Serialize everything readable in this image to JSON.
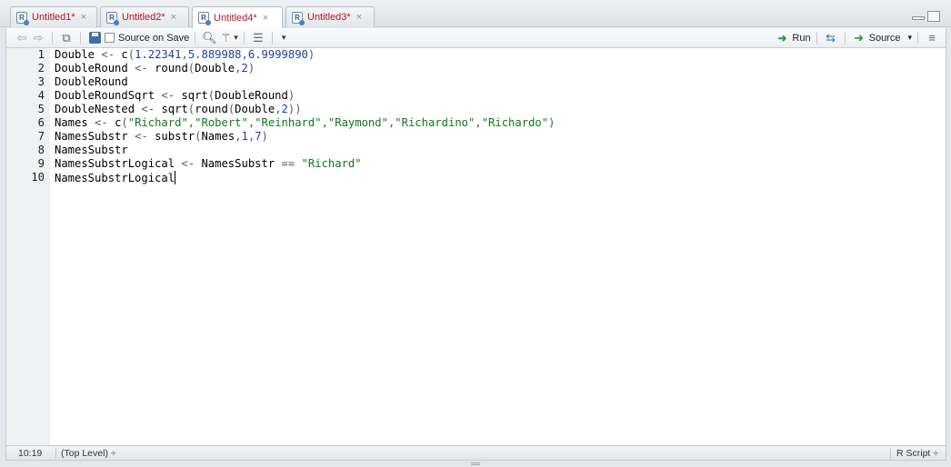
{
  "tabs": [
    {
      "label": "Untitled1*",
      "close": "×"
    },
    {
      "label": "Untitled2*",
      "close": "×"
    },
    {
      "label": "Untitled4*",
      "close": "×"
    },
    {
      "label": "Untitled3*",
      "close": "×"
    }
  ],
  "toolbar": {
    "source_on_save": "Source on Save",
    "run": "Run",
    "source": "Source",
    "dropdown_arrow": "▾"
  },
  "editor": {
    "line_numbers": [
      "1",
      "2",
      "3",
      "4",
      "5",
      "6",
      "7",
      "8",
      "9",
      "10"
    ],
    "lines": [
      "Double <- c(1.22341,5.889988,6.9999890)",
      "DoubleRound <- round(Double,2)",
      "DoubleRound",
      "DoubleRoundSqrt <- sqrt(DoubleRound)",
      "DoubleNested <- sqrt(round(Double,2))",
      "Names <- c(\"Richard\",\"Robert\",\"Reinhard\",\"Raymond\",\"Richardino\",\"Richardo\")",
      "NamesSubstr <- substr(Names,1,7)",
      "NamesSubstr",
      "NamesSubstrLogical <- NamesSubstr == \"Richard\"",
      "NamesSubstrLogical"
    ]
  },
  "statusbar": {
    "position": "10:19",
    "scope": "(Top Level) ÷",
    "file_type": "R Script ÷"
  },
  "colors": {
    "tab_label": "#b0182a",
    "number": "#1d3ea6",
    "string": "#0f7a18",
    "run_arrow": "#2b9a3b"
  }
}
